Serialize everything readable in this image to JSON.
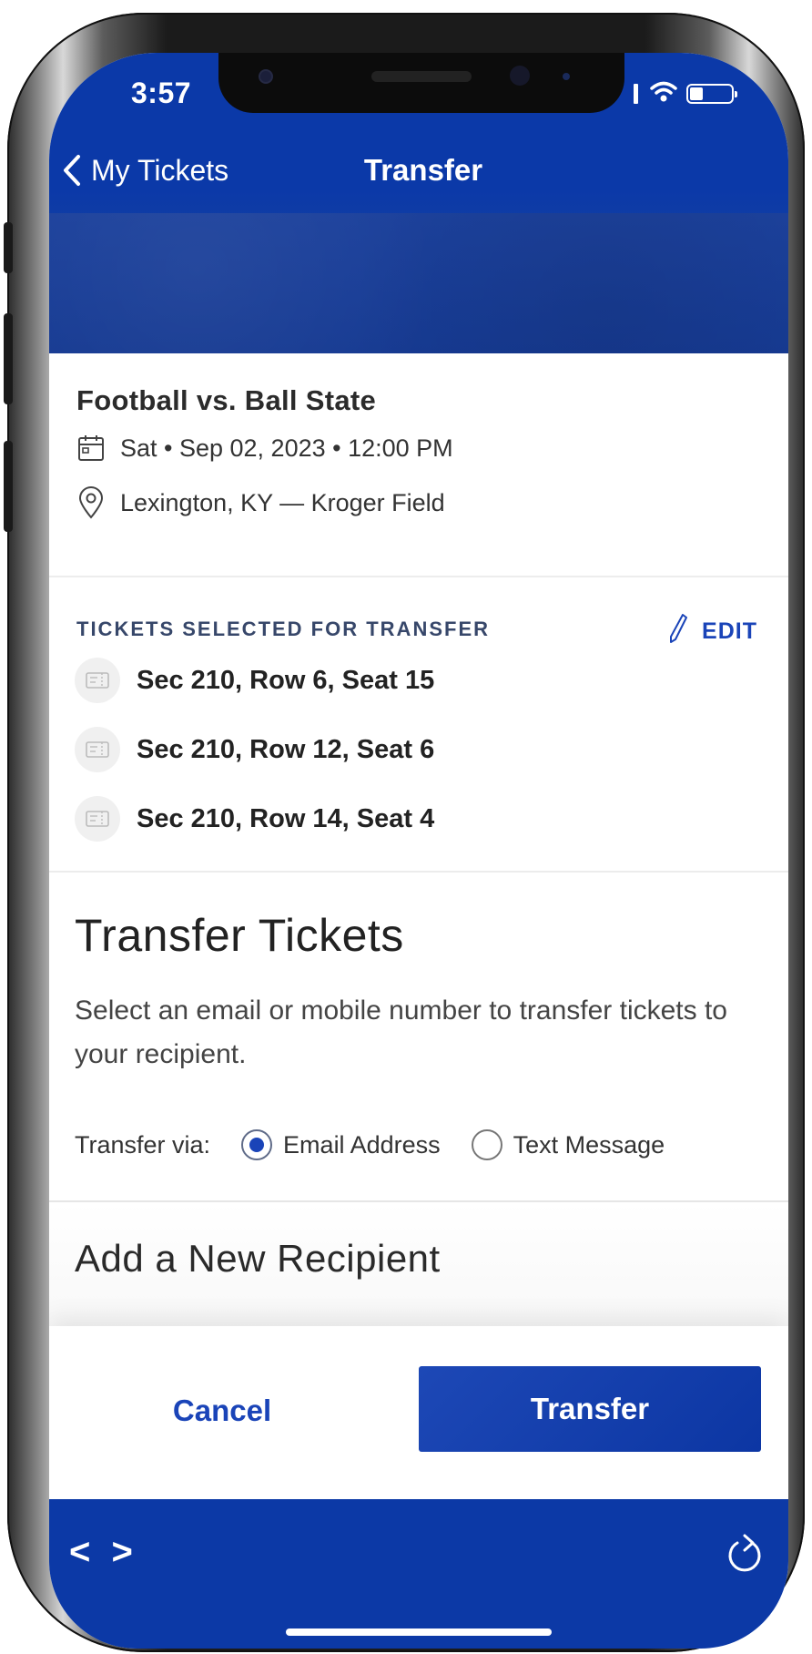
{
  "status_bar": {
    "time": "3:57"
  },
  "nav": {
    "back_label": "My Tickets",
    "title": "Transfer"
  },
  "event": {
    "title": "Football vs. Ball State",
    "datetime": "Sat • Sep 02, 2023 • 12:00 PM",
    "location": "Lexington, KY — Kroger Field",
    "icons": [
      "calendar-icon",
      "location-pin-icon"
    ]
  },
  "tickets": {
    "heading": "TICKETS SELECTED FOR TRANSFER",
    "edit_label": "EDIT",
    "items": [
      {
        "label": "Sec 210, Row 6, Seat 15"
      },
      {
        "label": "Sec 210, Row 12, Seat 6"
      },
      {
        "label": "Sec 210, Row 14, Seat 4"
      }
    ]
  },
  "transfer": {
    "heading": "Transfer Tickets",
    "description": "Select an email or mobile number to transfer tickets to your recipient.",
    "via_label": "Transfer via:",
    "options": [
      {
        "label": "Email Address",
        "selected": true
      },
      {
        "label": "Text Message",
        "selected": false
      }
    ]
  },
  "recipient": {
    "heading": "Add a New Recipient"
  },
  "actions": {
    "cancel_label": "Cancel",
    "transfer_label": "Transfer"
  },
  "browser_bar": {
    "nav_label": "< >"
  },
  "colors": {
    "brand_blue": "#0b39a8",
    "accent_blue": "#1a44b8",
    "text_dark": "#222222"
  }
}
